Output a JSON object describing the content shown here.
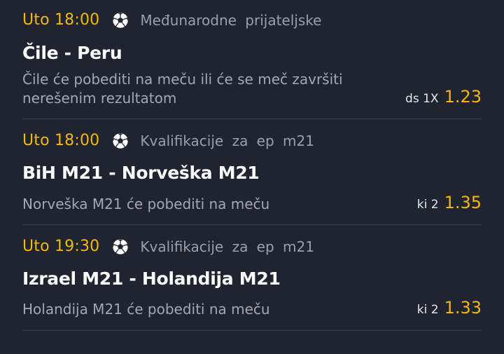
{
  "matches": [
    {
      "time": "Uto 18:00",
      "sport_icon": "soccer-ball-icon",
      "league": "Međunarodne  prijateljske",
      "teams": "Čile - Peru",
      "description_line1": "Čile će pobediti na meču ili će se meč završiti",
      "description_line2": "nerešenim rezultatom",
      "bet_type": "ds 1X",
      "odd": "1.23"
    },
    {
      "time": "Uto 18:00",
      "sport_icon": "soccer-ball-icon",
      "league": "Kvalifikacije  za  ep  m21",
      "teams": "BiH M21 - Norveška M21",
      "description_line1": "Norveška M21  će pobediti na meču",
      "description_line2": "",
      "bet_type": "ki 2",
      "odd": "1.35"
    },
    {
      "time": "Uto 19:30",
      "sport_icon": "soccer-ball-icon",
      "league": "Kvalifikacije  za  ep  m21",
      "teams": "Izrael M21 - Holandija M21",
      "description_line1": "Holandija M21  će pobediti na meču",
      "description_line2": "",
      "bet_type": "ki 2",
      "odd": "1.33"
    }
  ],
  "colors": {
    "background": "#1f2430",
    "accent": "#f5b800",
    "muted_text": "#9aa0ab",
    "divider": "#3a404d"
  }
}
